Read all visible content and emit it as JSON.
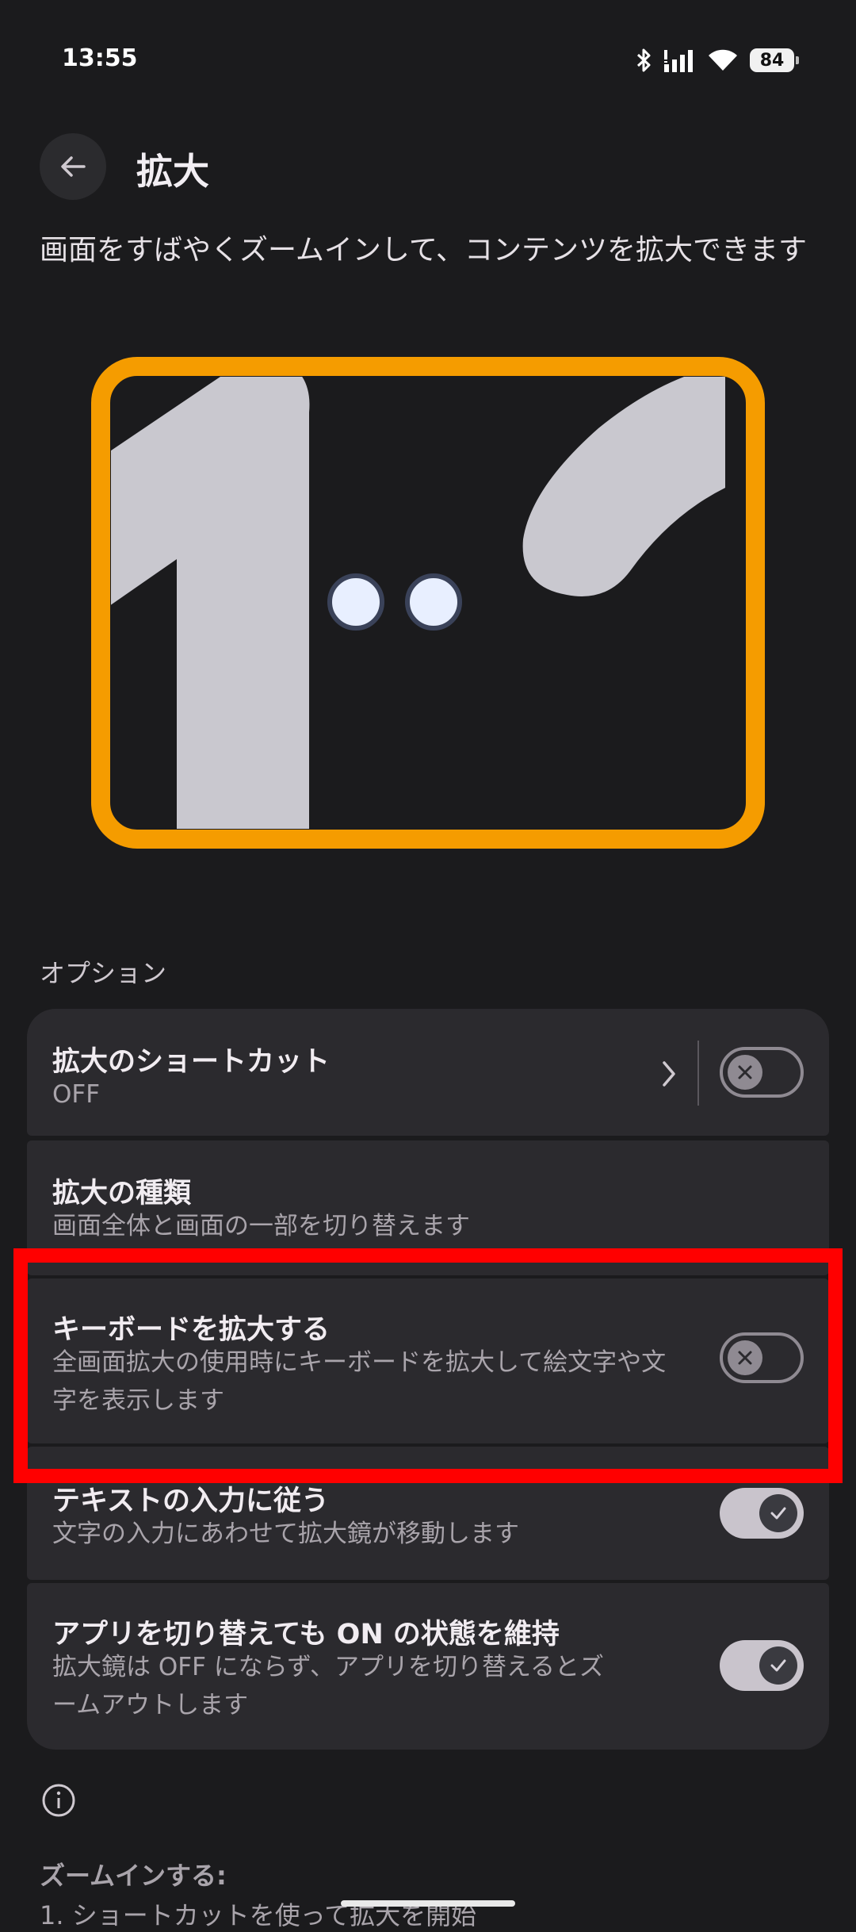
{
  "status_bar": {
    "time": "13:55",
    "battery": "84",
    "icons": [
      "bluetooth-icon",
      "signal-icon",
      "wifi-icon",
      "battery-icon"
    ]
  },
  "header": {
    "title": "拡大",
    "description": "画面をすばやくズームインして、コンテンツを拡大できます"
  },
  "colors": {
    "accent_frame": "#f59c00",
    "card_bg": "#2b2a2e",
    "highlight": "#ff0000"
  },
  "options": {
    "section_label": "オプション",
    "items": [
      {
        "title": "拡大のショートカット",
        "subtitle": "OFF",
        "toggle": "off"
      },
      {
        "title": "拡大の種類",
        "subtitle": "画面全体と画面の一部を切り替えます"
      },
      {
        "title": "キーボードを拡大する",
        "subtitle": "全画面拡大の使用時にキーボードを拡大して絵文字や文字を表示します",
        "toggle": "off"
      },
      {
        "title": "テキストの入力に従う",
        "subtitle": "文字の入力にあわせて拡大鏡が移動します",
        "toggle": "on"
      },
      {
        "title": "アプリを切り替えても ON の状態を維持",
        "subtitle": "拡大鏡は OFF にならず、アプリを切り替えるとズームアウトします",
        "toggle": "on"
      }
    ]
  },
  "help": {
    "title": "ズームインする:",
    "step1": "1. ショートカットを使って拡大を開始"
  }
}
